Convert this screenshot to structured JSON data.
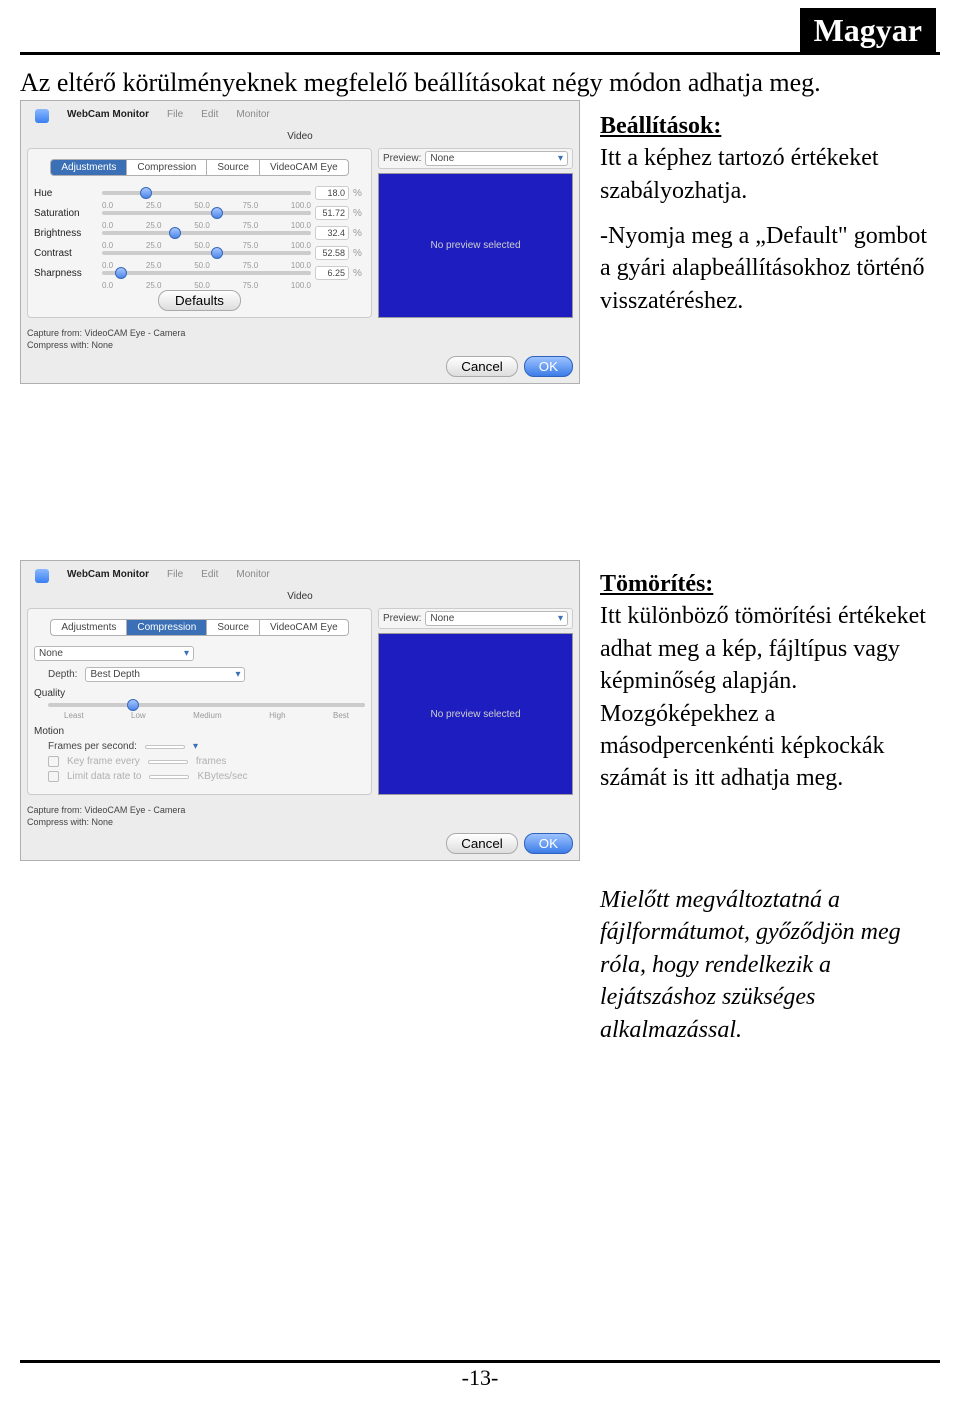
{
  "header": {
    "language": "Magyar"
  },
  "intro": "Az eltérő körülményeknek megfelelő beállításokat négy módon adhatja meg.",
  "page_number": "-13-",
  "screenshot1": {
    "menubar": {
      "app": "WebCam Monitor",
      "items": [
        "File",
        "Edit",
        "Monitor"
      ]
    },
    "window_title": "Video",
    "tabs": [
      "Adjustments",
      "Compression",
      "Source",
      "VideoCAM Eye"
    ],
    "selected_tab": "Adjustments",
    "sliders": [
      {
        "name": "Hue",
        "ticks": [
          "0.0",
          "25.0",
          "50.0",
          "75.0",
          "100.0"
        ],
        "value": "18.0",
        "pct": "%",
        "pos": 18
      },
      {
        "name": "Saturation",
        "ticks": [
          "0.0",
          "25.0",
          "50.0",
          "75.0",
          "100.0"
        ],
        "value": "51.72",
        "pct": "%",
        "pos": 52
      },
      {
        "name": "Brightness",
        "ticks": [
          "0.0",
          "25.0",
          "50.0",
          "75.0",
          "100.0"
        ],
        "value": "32.4",
        "pct": "%",
        "pos": 32
      },
      {
        "name": "Contrast",
        "ticks": [
          "0.0",
          "25.0",
          "50.0",
          "75.0",
          "100.0"
        ],
        "value": "52.58",
        "pct": "%",
        "pos": 52
      },
      {
        "name": "Sharpness",
        "ticks": [
          "0.0",
          "25.0",
          "50.0",
          "75.0",
          "100.0"
        ],
        "value": "6.25",
        "pct": "%",
        "pos": 6
      }
    ],
    "defaults_button": "Defaults",
    "preview": {
      "label": "Preview:",
      "selected": "None",
      "placeholder": "No preview selected"
    },
    "footer": {
      "line1_label": "Capture from:",
      "line1_value": "VideoCAM Eye - Camera",
      "line2_label": "Compress with:",
      "line2_value": "None"
    },
    "buttons": {
      "cancel": "Cancel",
      "ok": "OK"
    }
  },
  "screenshot2": {
    "menubar": {
      "app": "WebCam Monitor",
      "items": [
        "File",
        "Edit",
        "Monitor"
      ]
    },
    "window_title": "Video",
    "tabs": [
      "Adjustments",
      "Compression",
      "Source",
      "VideoCAM Eye"
    ],
    "selected_tab": "Compression",
    "codec": {
      "value": "None"
    },
    "depth": {
      "label": "Depth:",
      "value": "Best Depth"
    },
    "quality": {
      "label": "Quality",
      "levels": [
        "Least",
        "Low",
        "Medium",
        "High",
        "Best"
      ],
      "selected": "Low"
    },
    "motion": {
      "label": "Motion",
      "fps_label": "Frames per second:",
      "fps_value": "",
      "key_label": "Key frame every",
      "key_value": "",
      "key_unit": "frames",
      "limit_label": "Limit data rate to",
      "limit_value": "",
      "limit_unit": "KBytes/sec"
    },
    "preview": {
      "label": "Preview:",
      "selected": "None",
      "placeholder": "No preview selected"
    },
    "footer": {
      "line1_label": "Capture from:",
      "line1_value": "VideoCAM Eye - Camera",
      "line2_label": "Compress with:",
      "line2_value": "None"
    },
    "buttons": {
      "cancel": "Cancel",
      "ok": "OK"
    }
  },
  "desc1": {
    "title": "Beállítások:",
    "body": "Itt a képhez tartozó értékeket szabályozhatja."
  },
  "desc2": "-Nyomja meg a „Default\" gombot a gyári alapbeállításokhoz történő visszatéréshez.",
  "desc3": {
    "title": "Tömörítés:",
    "body": "Itt különböző tömörítési értékeket adhat meg a kép, fájltípus vagy képminőség alapján. Mozgóképekhez a másodpercenkénti képkockák számát is itt adhatja meg."
  },
  "desc4": "Mielőtt megváltoztatná a fájlformátumot, győződjön meg róla, hogy rendelkezik a lejátszáshoz szükséges alkalmazással."
}
